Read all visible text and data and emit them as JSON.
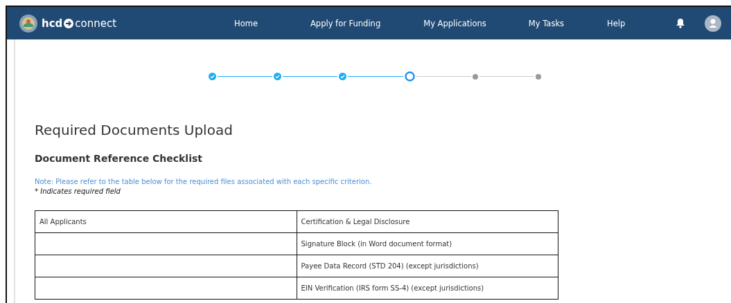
{
  "header": {
    "brand_bold": "hcd",
    "brand_light": "connect",
    "nav": [
      {
        "label": "Home"
      },
      {
        "label": "Apply for Funding"
      },
      {
        "label": "My Applications"
      },
      {
        "label": "My Tasks"
      },
      {
        "label": "Help"
      }
    ]
  },
  "stepper": [
    {
      "kind": "complete"
    },
    {
      "kind": "complete"
    },
    {
      "kind": "complete"
    },
    {
      "kind": "current"
    },
    {
      "kind": "upcoming"
    },
    {
      "kind": "upcoming"
    }
  ],
  "title": "Required Documents Upload",
  "subtitle": "Document Reference Checklist",
  "note": "Note: Please refer to the table below for the required files associated with each specific criterion.",
  "required_hint": "* Indicates required field",
  "table": {
    "rows": [
      {
        "cells": [
          "All Applicants",
          "Certification & Legal Disclosure"
        ]
      },
      {
        "cells": [
          "",
          "Signature Block (in Word document format)"
        ]
      },
      {
        "cells": [
          "",
          "Payee Data Record (STD 204) (except jurisdictions)"
        ]
      },
      {
        "cells": [
          "",
          "EIN Verification (IRS form SS-4) (except jurisdictions)"
        ]
      }
    ]
  }
}
